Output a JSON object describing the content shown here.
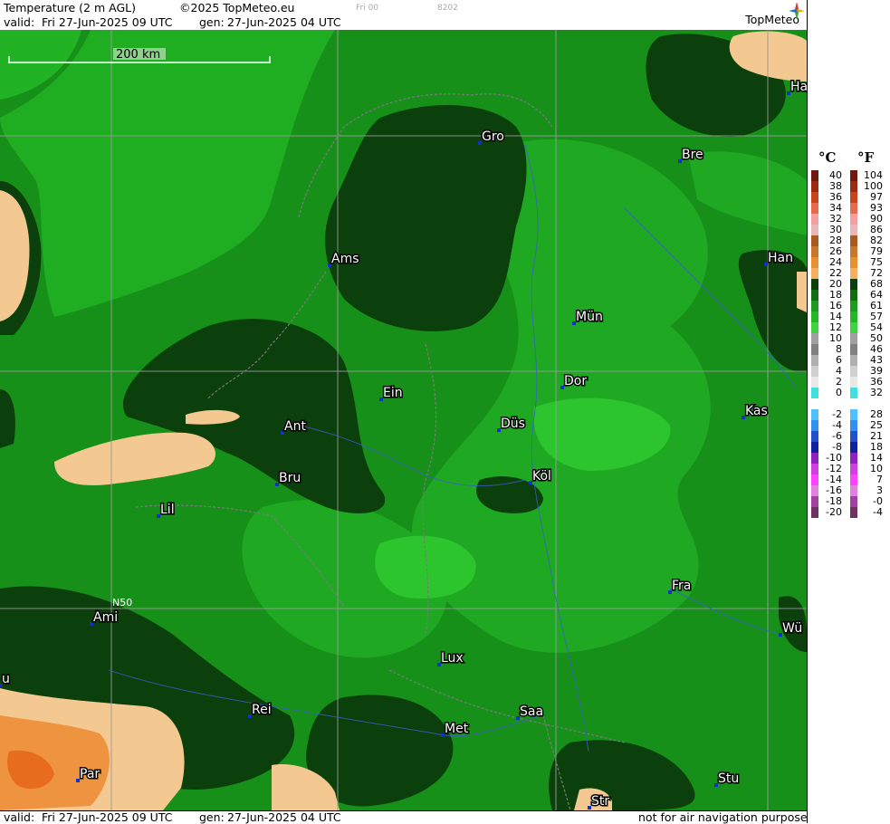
{
  "header": {
    "product": "Temperature (2 m AGL)",
    "copyright": "©2025 TopMeteo.eu",
    "run_code": "Fri 00",
    "code2": "8202",
    "valid_label": "valid:",
    "valid_value": "Fri 27-Jun-2025 09 UTC",
    "gen_label": "gen:",
    "gen_value": "27-Jun-2025 04 UTC",
    "logo": "TopMeteo"
  },
  "footer": {
    "valid_label": "valid:",
    "valid_value": "Fri 27-Jun-2025 09 UTC",
    "gen_label": "gen:",
    "gen_value": "27-Jun-2025 04 UTC",
    "disclaimer": "not for air navigation purposes"
  },
  "map": {
    "scale_label": "200 km",
    "lat_label": "N50",
    "cities": [
      "Ha",
      "Gro",
      "Bre",
      "Ams",
      "Han",
      "Mün",
      "Ein",
      "Dor",
      "Düs",
      "Kas",
      "Ant",
      "Köl",
      "Bru",
      "Lil",
      "Fra",
      "Ami",
      "Wü",
      "Lux",
      "Saa",
      "Rei",
      "Met",
      "Par",
      "Stu",
      "Str",
      "u"
    ]
  },
  "legend": {
    "celsius_unit": "°C",
    "fahrenheit_unit": "°F",
    "celsius_labels": [
      "40",
      "38",
      "36",
      "34",
      "32",
      "30",
      "28",
      "26",
      "24",
      "22",
      "20",
      "18",
      "16",
      "14",
      "12",
      "10",
      "8",
      "6",
      "4",
      "2",
      "0",
      "-2",
      "-4",
      "-6",
      "-8",
      "-10",
      "-12",
      "-14",
      "-16",
      "-18",
      "-20"
    ],
    "fahrenheit_labels": [
      "104",
      "100",
      "97",
      "93",
      "90",
      "86",
      "82",
      "79",
      "75",
      "72",
      "68",
      "64",
      "61",
      "57",
      "54",
      "50",
      "46",
      "43",
      "39",
      "36",
      "32",
      "28",
      "25",
      "21",
      "18",
      "14",
      "10",
      "7",
      "3",
      "-0",
      "-4"
    ],
    "colors": [
      "#6e1a10",
      "#9a2a10",
      "#c8451c",
      "#e86a4a",
      "#f5a0a0",
      "#e8b8b8",
      "#a85a20",
      "#c8782a",
      "#e89030",
      "#f4b060",
      "#0c3e0c",
      "#136c13",
      "#1e9b1e",
      "#23b723",
      "#3fd43f",
      "#a0a0a0",
      "#808080",
      "#b0b0b0",
      "#d0d0d0",
      "#e8e8e8",
      "#40e0e0",
      "#50c0ff",
      "#3090f0",
      "#2050d0",
      "#1020a0",
      "#9020c0",
      "#d040e0",
      "#ff40ff",
      "#e080e0",
      "#a040a0",
      "#703060"
    ]
  }
}
